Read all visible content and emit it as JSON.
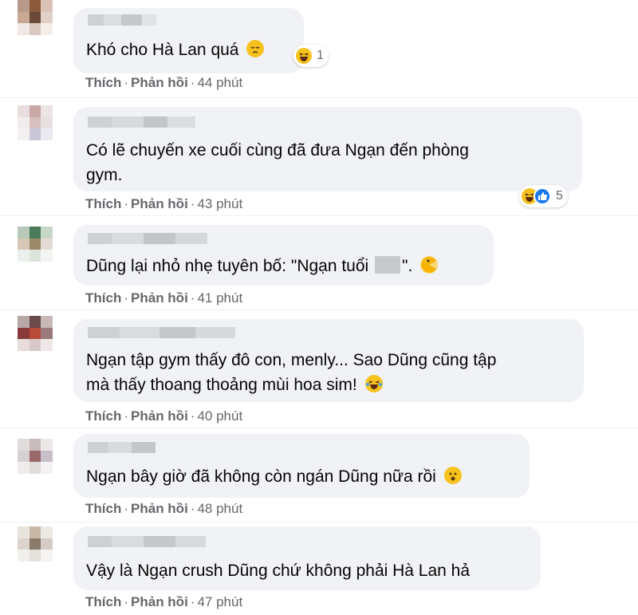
{
  "comments": [
    {
      "text": "Khó cho Hà Lan quá",
      "emoji": "pensive-face-emoji",
      "reaction_count": "1",
      "like_label": "Thích",
      "reply_label": "Phản hồi",
      "time": "44 phút"
    },
    {
      "text_line1": "Có lẽ chuyến xe cuối cùng đã đưa Ngạn đến phòng",
      "text_line2": "gym.",
      "reaction_count": "5",
      "like_label": "Thích",
      "reply_label": "Phản hồi",
      "time": "43 phút"
    },
    {
      "text_before": "Dũng lại nhỏ nhẹ tuyên bố: \"Ngạn tuổi ",
      "text_after": "\".",
      "emoji": "pacman-face-emoji",
      "like_label": "Thích",
      "reply_label": "Phản hồi",
      "time": "41 phút"
    },
    {
      "text_line1": "Ngạn tập gym thấy đô con, menly... Sao Dũng cũng tập",
      "text_line2": "mà thấy thoang thoảng mùi hoa sim!",
      "emoji": "laughing-tears-emoji",
      "like_label": "Thích",
      "reply_label": "Phản hồi",
      "time": "40 phút"
    },
    {
      "text": "Ngạn bây giờ đã không còn ngán Dũng nữa rồi",
      "emoji": "hushed-face-emoji",
      "like_label": "Thích",
      "reply_label": "Phản hồi",
      "time": "48 phút"
    },
    {
      "text": "Vậy là Ngạn crush Dũng chứ không phải Hà Lan hả",
      "like_label": "Thích",
      "reply_label": "Phản hồi",
      "time": "47 phút"
    }
  ],
  "separator": "·",
  "colors": {
    "bubble": "#f0f2f5",
    "meta_text": "#65676b",
    "like_blue": "#1877f2",
    "emoji_yellow": "#f7c21e"
  }
}
